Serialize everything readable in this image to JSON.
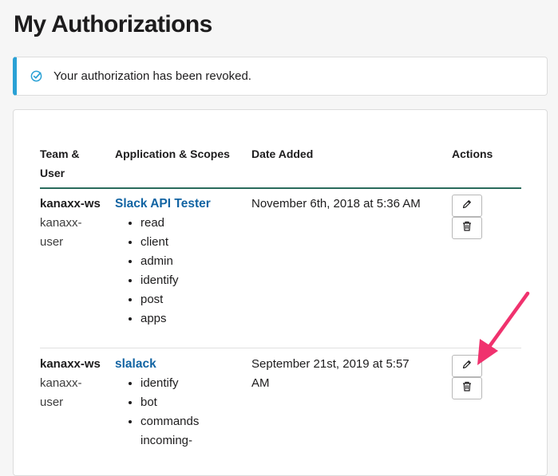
{
  "page": {
    "title": "My Authorizations"
  },
  "alert": {
    "message": "Your authorization has been revoked.",
    "icon": "check-circle-icon",
    "accent": "#2aa1d5"
  },
  "table": {
    "headers": [
      "Team & User",
      "Application & Scopes",
      "Date Added",
      "Actions"
    ],
    "header_lines": {
      "team": [
        "Team &",
        "User"
      ]
    },
    "rows": [
      {
        "team": "kanaxx-ws",
        "user_lines": [
          "kanaxx-",
          "user"
        ],
        "app": "Slack API Tester",
        "scopes": [
          "read",
          "client",
          "admin",
          "identify",
          "post",
          "apps"
        ],
        "date_lines": [
          "November 6th, 2018 at 5:36 AM"
        ]
      },
      {
        "team": "kanaxx-ws",
        "user_lines": [
          "kanaxx-",
          "user"
        ],
        "app": "slalack",
        "scopes": [
          "identify",
          "bot",
          "commands",
          "incoming-"
        ],
        "date_lines": [
          "September 21st, 2019 at 5:57",
          "AM"
        ]
      }
    ],
    "actions": {
      "edit_icon": "pencil-icon",
      "delete_icon": "trash-icon"
    }
  },
  "colors": {
    "link": "#1264a3",
    "header_rule": "#2a6b5c",
    "annotation_arrow": "#f0326e"
  }
}
